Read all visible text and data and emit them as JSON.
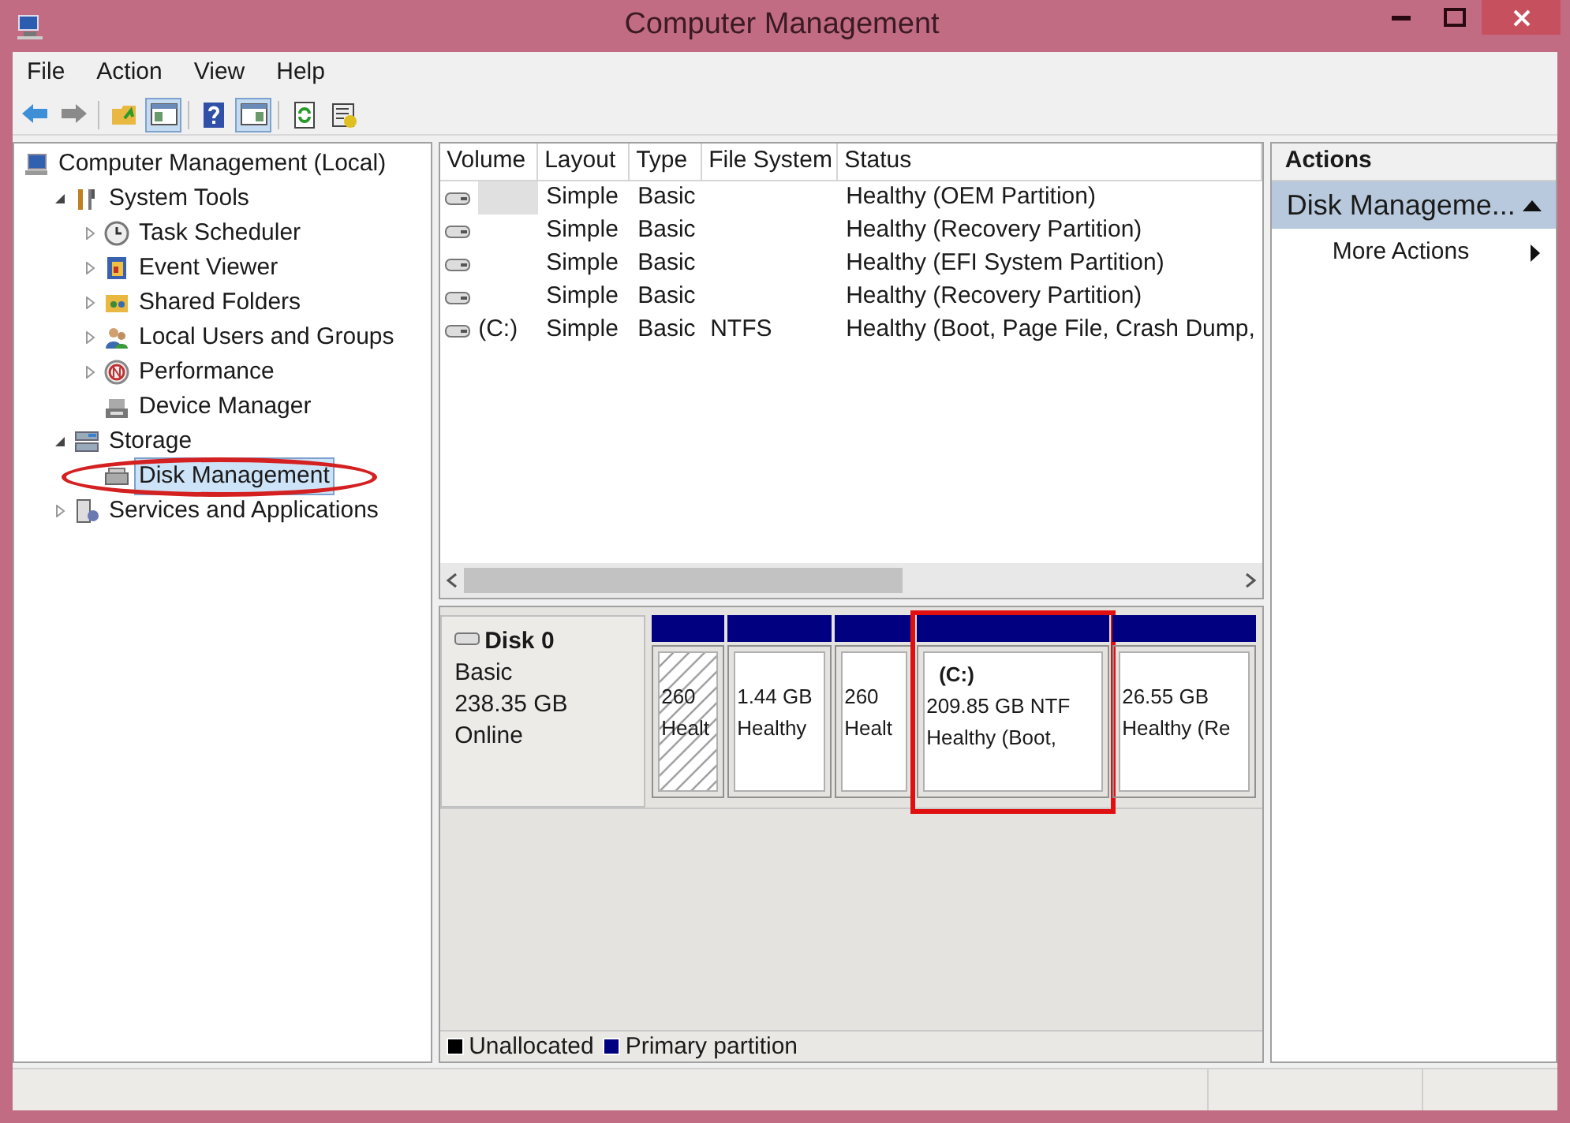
{
  "window": {
    "title": "Computer Management"
  },
  "menu": [
    "File",
    "Action",
    "View",
    "Help"
  ],
  "toolbar": [
    {
      "kind": "back",
      "pressed": false
    },
    {
      "kind": "forward",
      "pressed": false
    },
    {
      "kind": "up",
      "pressed": false
    },
    {
      "kind": "tree-pane",
      "pressed": true
    },
    {
      "kind": "help",
      "pressed": false
    },
    {
      "kind": "action-pane",
      "pressed": true
    },
    {
      "kind": "refresh",
      "pressed": false
    },
    {
      "kind": "properties",
      "pressed": false
    }
  ],
  "tree": [
    {
      "label": "Computer Management (Local)",
      "kind": "computer",
      "selected": false,
      "children": [
        {
          "label": "System Tools",
          "kind": "tools",
          "expanded": true,
          "selected": false,
          "children": [
            {
              "label": "Task Scheduler",
              "kind": "clock",
              "expanded": false,
              "selected": false
            },
            {
              "label": "Event Viewer",
              "kind": "log",
              "expanded": false,
              "selected": false
            },
            {
              "label": "Shared Folders",
              "kind": "share",
              "expanded": false,
              "selected": false
            },
            {
              "label": "Local Users and Groups",
              "kind": "users",
              "expanded": false,
              "selected": false
            },
            {
              "label": "Performance",
              "kind": "gauge",
              "expanded": false,
              "selected": false
            },
            {
              "label": "Device Manager",
              "kind": "device",
              "selected": false
            }
          ]
        },
        {
          "label": "Storage",
          "kind": "storage",
          "expanded": true,
          "selected": false,
          "children": [
            {
              "label": "Disk Management",
              "kind": "disk",
              "selected": true,
              "circled": true
            }
          ]
        },
        {
          "label": "Services and Applications",
          "kind": "services",
          "expanded": false,
          "selected": false
        }
      ]
    }
  ],
  "volumes": {
    "columns": [
      "Volume",
      "Layout",
      "Type",
      "File System",
      "Status"
    ],
    "rows": [
      {
        "volume": "",
        "layout": "Simple",
        "type": "Basic",
        "file_system": "",
        "status": "Healthy (OEM Partition)",
        "selected": true
      },
      {
        "volume": "",
        "layout": "Simple",
        "type": "Basic",
        "file_system": "",
        "status": "Healthy (Recovery Partition)",
        "selected": false
      },
      {
        "volume": "",
        "layout": "Simple",
        "type": "Basic",
        "file_system": "",
        "status": "Healthy (EFI System Partition)",
        "selected": false
      },
      {
        "volume": "",
        "layout": "Simple",
        "type": "Basic",
        "file_system": "",
        "status": "Healthy (Recovery Partition)",
        "selected": false
      },
      {
        "volume": "(C:)",
        "layout": "Simple",
        "type": "Basic",
        "file_system": "NTFS",
        "status": "Healthy (Boot, Page File, Crash Dump,",
        "selected": false
      }
    ]
  },
  "disk": {
    "name": "Disk 0",
    "type": "Basic",
    "size": "238.35 GB",
    "state": "Online",
    "partitions": [
      {
        "lines": [
          "260",
          "Healt"
        ],
        "selected": true,
        "highlighted": false
      },
      {
        "lines": [
          "1.44 GB",
          "Healthy"
        ],
        "selected": false,
        "highlighted": false
      },
      {
        "lines": [
          "260",
          "Healt"
        ],
        "selected": false,
        "highlighted": false
      },
      {
        "title": "(C:)",
        "lines": [
          "209.85 GB NTF",
          "Healthy (Boot,"
        ],
        "selected": false,
        "highlighted": true
      },
      {
        "lines": [
          "26.55 GB",
          "Healthy (Re"
        ],
        "selected": false,
        "highlighted": false
      }
    ]
  },
  "legend": [
    {
      "label": "Unallocated",
      "color": "#000000"
    },
    {
      "label": "Primary partition",
      "color": "#000080"
    }
  ],
  "actions": {
    "title": "Actions",
    "section": "Disk Manageme...",
    "items": [
      "More Actions"
    ]
  }
}
